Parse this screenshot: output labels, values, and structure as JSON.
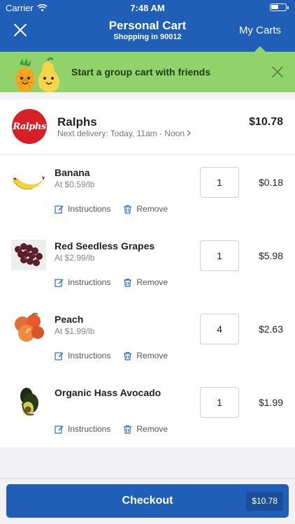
{
  "status_bar": {
    "carrier": "Carrier",
    "time": "7:48 AM"
  },
  "header": {
    "title": "Personal Cart",
    "subtitle": "Shopping in 90012",
    "my_carts_label": "My Carts"
  },
  "promo": {
    "text": "Start a group cart with friends"
  },
  "store": {
    "logo_text": "Ralphs",
    "name": "Ralphs",
    "delivery": "Next delivery: Today, 11am - Noon",
    "total": "$10.78"
  },
  "action_labels": {
    "instructions": "Instructions",
    "remove": "Remove"
  },
  "items": [
    {
      "name": "Banana",
      "unit_price": "At $0.59/lb",
      "quantity": "1",
      "price": "$0.18",
      "icon": "banana-image"
    },
    {
      "name": "Red Seedless Grapes",
      "unit_price": "At $2.99/lb",
      "quantity": "1",
      "price": "$5.98",
      "icon": "grapes-image"
    },
    {
      "name": "Peach",
      "unit_price": "At $1.99/lb",
      "quantity": "4",
      "price": "$2.63",
      "icon": "peach-image"
    },
    {
      "name": "Organic Hass Avocado",
      "unit_price": "",
      "quantity": "1",
      "price": "$1.99",
      "icon": "avocado-image"
    }
  ],
  "checkout": {
    "label": "Checkout",
    "amount": "$10.78"
  },
  "colors": {
    "header_blue": "#1f5fb8",
    "promo_green": "#8fd36a",
    "ralphs_red": "#d71f25"
  }
}
